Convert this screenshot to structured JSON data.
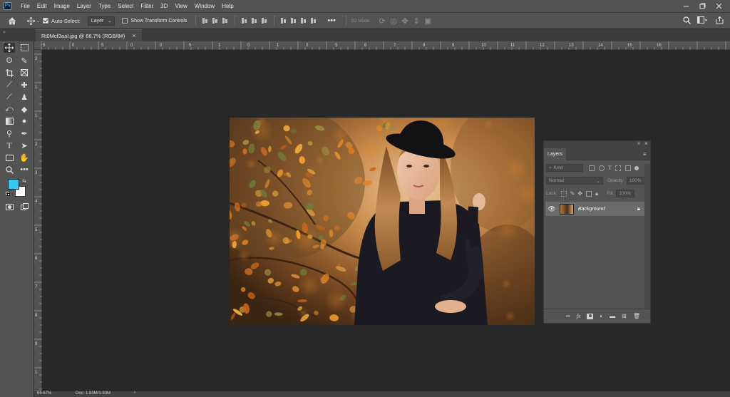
{
  "menubar": {
    "items": [
      "File",
      "Edit",
      "Image",
      "Layer",
      "Type",
      "Select",
      "Filter",
      "3D",
      "View",
      "Window",
      "Help"
    ],
    "app_logo": "Ps"
  },
  "options_bar": {
    "auto_select_label": "Auto-Select:",
    "auto_select_checked": true,
    "layer_dropdown": "Layer",
    "show_transform_label": "Show Transform Controls",
    "show_transform_checked": false,
    "mode_3d_label": "3D Mode:",
    "more_label": "•••"
  },
  "document": {
    "tab_title": "Rt0Mcf3aaI.jpg @ 66.7% (RGB/8#)",
    "close_glyph": "×"
  },
  "ruler": {
    "top_labels": [
      "5",
      "0",
      "5",
      "0",
      "0",
      "5",
      "1",
      "0",
      "1",
      "0",
      "5",
      "6",
      "7",
      "8",
      "9",
      "10",
      "11",
      "12",
      "13",
      "14",
      "15",
      "16"
    ],
    "left_labels": [
      "2",
      "1",
      "1",
      "2",
      "3",
      "4",
      "5",
      "6",
      "7",
      "8",
      "9",
      "1"
    ]
  },
  "layers_panel": {
    "tab_label": "Layers",
    "kind_placeholder": "Kind",
    "blend_mode": "Normal",
    "opacity_label": "Opacity:",
    "opacity_value": "100%",
    "lock_label": "Lock:",
    "fill_label": "Fill:",
    "fill_value": "100%",
    "layer_name": "Background"
  },
  "status": {
    "zoom": "66.67%",
    "doc_info": "Doc: 1.93M/1.93M"
  },
  "colors": {
    "foreground": "#38c7f5",
    "background": "#ffffff",
    "ui_panel": "#535353",
    "workspace": "#282828"
  },
  "icons": {
    "home": "home-icon",
    "move": "move-icon",
    "search": "search-icon",
    "workspace": "workspace-icon",
    "share": "share-icon",
    "eye": "eye-icon",
    "lock": "lock-icon"
  }
}
